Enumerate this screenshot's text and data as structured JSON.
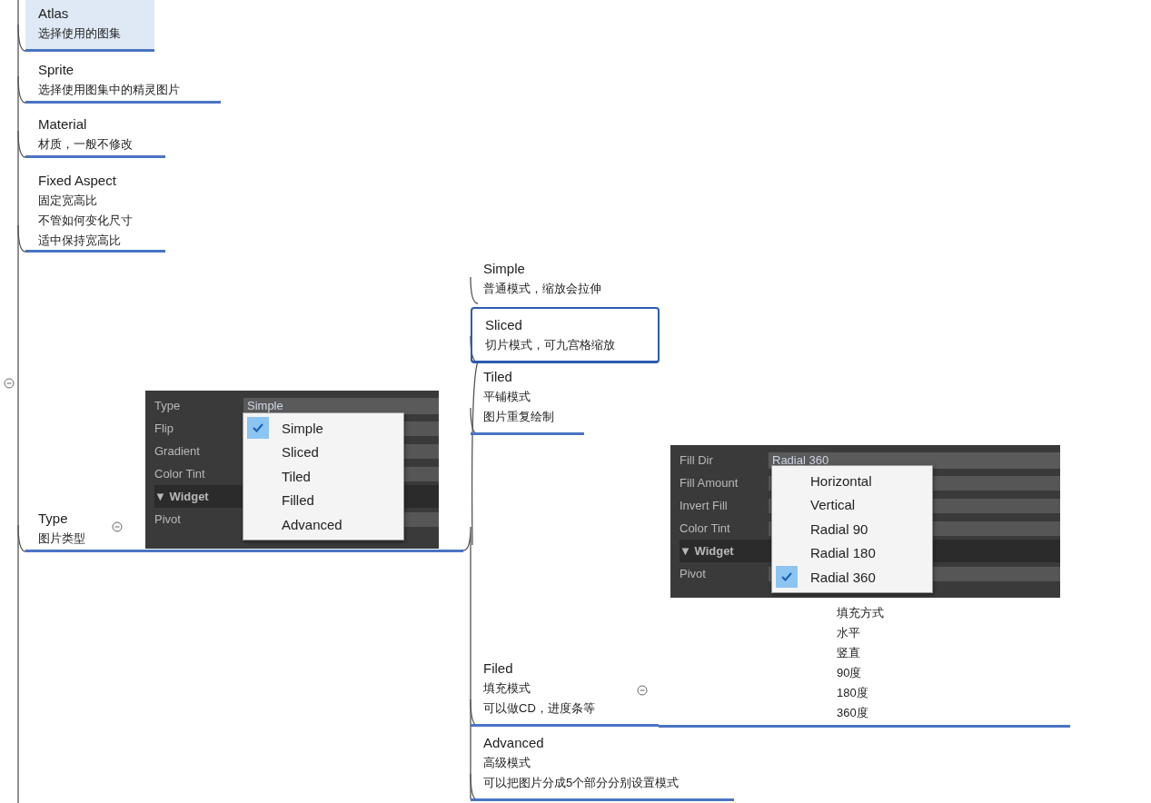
{
  "root": {
    "collapsible": true
  },
  "nodes": [
    {
      "title": "Atlas",
      "lines": [
        "选择使用的图集"
      ],
      "hovered": true
    },
    {
      "title": "Sprite",
      "lines": [
        "选择使用图集中的精灵图片"
      ],
      "hovered": false
    },
    {
      "title": "Material",
      "lines": [
        "材质，一般不修改"
      ],
      "hovered": false
    },
    {
      "title": "Fixed Aspect",
      "lines": [
        "固定宽高比",
        "不管如何变化尺寸",
        "适中保持宽高比"
      ],
      "hovered": false
    },
    {
      "title": "Type",
      "lines": [
        "图片类型"
      ],
      "hovered": false,
      "collapsible": true,
      "screenshot": {
        "rows": [
          {
            "kind": "dropdown",
            "label": "Type",
            "value": "Simple"
          },
          {
            "kind": "field",
            "label": "Flip"
          },
          {
            "kind": "field",
            "label": "Gradient"
          },
          {
            "kind": "field",
            "label": "Color Tint"
          },
          {
            "kind": "header",
            "label": "▼ Widget"
          },
          {
            "kind": "field",
            "label": "Pivot"
          }
        ],
        "options": [
          {
            "label": "Simple",
            "selected": true
          },
          {
            "label": "Sliced",
            "selected": false
          },
          {
            "label": "Tiled",
            "selected": false
          },
          {
            "label": "Filled",
            "selected": false
          },
          {
            "label": "Advanced",
            "selected": false
          }
        ]
      },
      "children": [
        {
          "title": "Simple",
          "lines": [
            "普通模式，缩放会拉伸"
          ],
          "selected": false
        },
        {
          "title": "Sliced",
          "lines": [
            "切片模式，可九宫格缩放"
          ],
          "selected": true
        },
        {
          "title": "Tiled",
          "lines": [
            "平铺模式",
            "图片重复绘制"
          ],
          "selected": false
        },
        {
          "title": "Filed",
          "lines": [
            "填充模式",
            "可以做CD，进度条等"
          ],
          "selected": false,
          "collapsible": true,
          "children": [
            {
              "lines": [
                "填充方式",
                "水平",
                "竖直",
                "90度",
                "180度",
                "360度"
              ],
              "screenshot": {
                "rows": [
                  {
                    "kind": "dropdown",
                    "label": "Fill Dir",
                    "value": "Radial 360"
                  },
                  {
                    "kind": "field",
                    "label": "Fill Amount"
                  },
                  {
                    "kind": "field",
                    "label": "Invert Fill"
                  },
                  {
                    "kind": "field",
                    "label": "Color Tint"
                  },
                  {
                    "kind": "header",
                    "label": "▼ Widget"
                  },
                  {
                    "kind": "field",
                    "label": "Pivot"
                  }
                ],
                "options": [
                  {
                    "label": "Horizontal",
                    "selected": false
                  },
                  {
                    "label": "Vertical",
                    "selected": false
                  },
                  {
                    "label": "Radial 90",
                    "selected": false
                  },
                  {
                    "label": "Radial 180",
                    "selected": false
                  },
                  {
                    "label": "Radial 360",
                    "selected": true
                  }
                ]
              }
            }
          ]
        },
        {
          "title": "Advanced",
          "lines": [
            "高级模式",
            "可以把图片分成5个部分分别设置模式"
          ],
          "selected": false
        }
      ]
    }
  ]
}
